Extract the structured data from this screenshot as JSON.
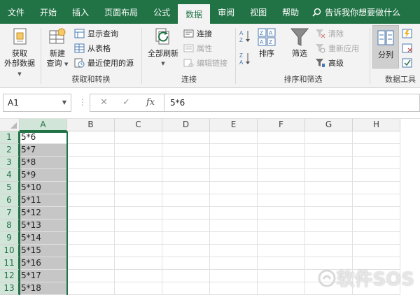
{
  "menu": {
    "tabs": [
      "文件",
      "开始",
      "插入",
      "页面布局",
      "公式",
      "数据",
      "审阅",
      "视图",
      "帮助"
    ],
    "active_tab": "数据",
    "tell_me": "告诉我你想要做什么"
  },
  "ribbon": {
    "get_data": {
      "line1": "获取",
      "line2": "外部数据"
    },
    "new_query": {
      "line1": "新建",
      "line2": "查询"
    },
    "show_queries": "显示查询",
    "from_table": "从表格",
    "recent_sources": "最近使用的源",
    "group_get_transform": "获取和转换",
    "refresh_all": "全部刷新",
    "connections": "连接",
    "properties": "属性",
    "edit_links": "编辑链接",
    "group_connections": "连接",
    "sort": "排序",
    "filter": "筛选",
    "clear": "清除",
    "reapply": "重新应用",
    "advanced": "高级",
    "group_sort_filter": "排序和筛选",
    "text_to_columns": "分列",
    "group_data_tools": "数据工具"
  },
  "formula_bar": {
    "name_box": "A1",
    "fx": "fx",
    "formula": "5*6"
  },
  "grid": {
    "columns": [
      "A",
      "B",
      "C",
      "D",
      "E",
      "F",
      "G",
      "H"
    ],
    "rows": [
      {
        "num": "1",
        "a": "5*6"
      },
      {
        "num": "2",
        "a": "5*7"
      },
      {
        "num": "3",
        "a": "5*8"
      },
      {
        "num": "4",
        "a": "5*9"
      },
      {
        "num": "5",
        "a": "5*10"
      },
      {
        "num": "6",
        "a": "5*11"
      },
      {
        "num": "7",
        "a": "5*12"
      },
      {
        "num": "8",
        "a": "5*13"
      },
      {
        "num": "9",
        "a": "5*14"
      },
      {
        "num": "10",
        "a": "5*15"
      },
      {
        "num": "11",
        "a": "5*16"
      },
      {
        "num": "12",
        "a": "5*17"
      },
      {
        "num": "13",
        "a": "5*18"
      }
    ]
  },
  "watermark": "软件SOS",
  "colors": {
    "excel_green": "#217346",
    "selection_gray": "#c6c6c6"
  }
}
